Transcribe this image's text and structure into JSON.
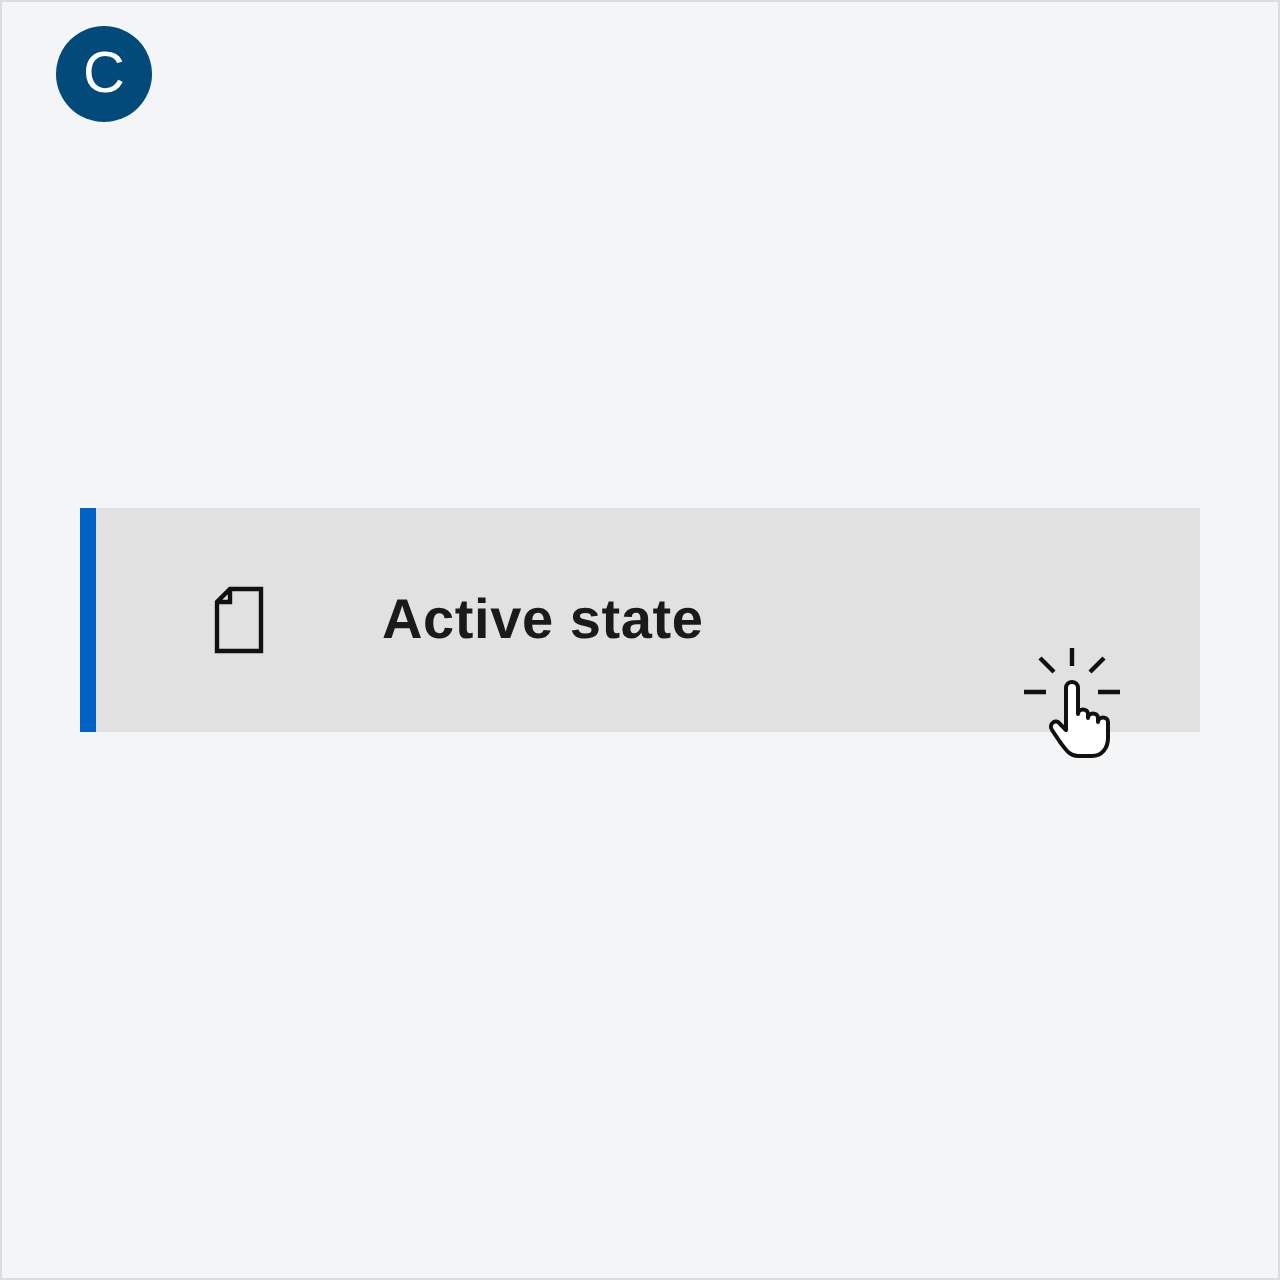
{
  "badge": {
    "letter": "C"
  },
  "nav_item": {
    "label": "Active state",
    "selected": true,
    "pointer": true
  }
}
